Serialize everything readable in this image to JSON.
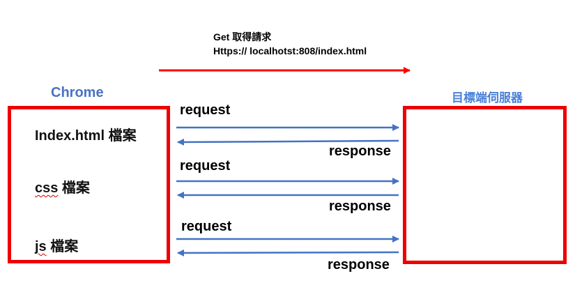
{
  "top_note": {
    "line1": "Get 取得請求",
    "line2": "Https:// localhotst:808/index.html"
  },
  "client": {
    "title": "Chrome",
    "files": [
      {
        "prefix": "Index.html",
        "suffix": " 檔案"
      },
      {
        "prefix": "css",
        "suffix": " 檔案"
      },
      {
        "prefix": "js",
        "suffix": " 檔案"
      }
    ]
  },
  "server": {
    "title": "目標端伺服器"
  },
  "exchanges": [
    {
      "request": "request",
      "response": "response"
    },
    {
      "request": "request",
      "response": "response"
    },
    {
      "request": "request",
      "response": "response"
    }
  ],
  "colors": {
    "box": "#ee0000",
    "arrow": "#4472c4",
    "main_arrow": "#ff0000",
    "client_title": "#4a72c4",
    "server_title": "#4a80d8"
  }
}
